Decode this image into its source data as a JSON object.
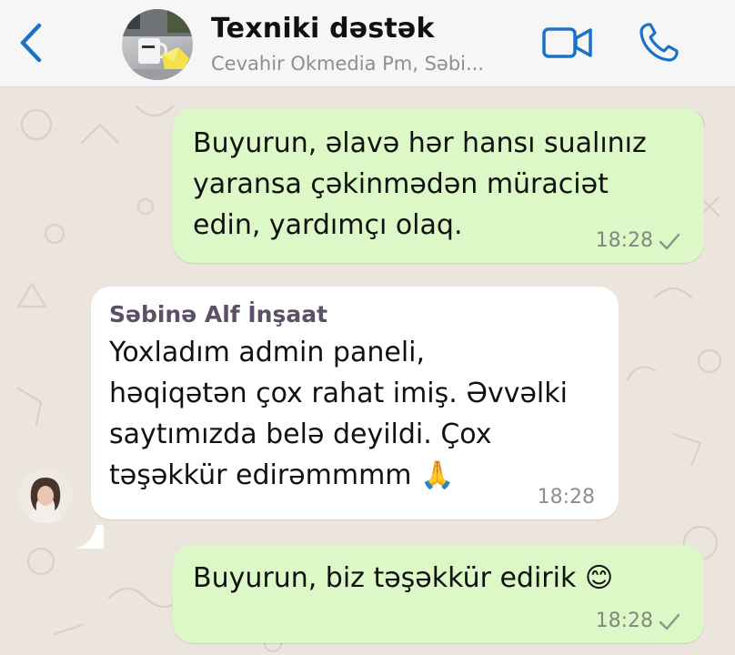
{
  "header": {
    "back_icon": "chevron-left-icon",
    "title": "Texniki dəstək",
    "subtitle": "Cevahir Okmedia Pm, Səbi...",
    "video_icon": "video-camera-icon",
    "call_icon": "phone-icon",
    "accent_color": "#1A73C8"
  },
  "messages": [
    {
      "direction": "outgoing",
      "lines": [
        "Buyurun, əlavə hər hansı sualınız",
        "yaransa çəkinmədən müraciət",
        "edin, yardımçı olaq."
      ],
      "time": "18:28",
      "status_icon": "single-check-icon"
    },
    {
      "direction": "incoming",
      "sender": "Səbinə Alf İnşaat",
      "lines": [
        "Yoxladım admin paneli,",
        "həqiqətən çox rahat imiş. Əvvəlki",
        "saytımızda belə deyildi. Çox",
        "təşəkkür edirəmmmm"
      ],
      "emoji": "🙏",
      "time": "18:28"
    },
    {
      "direction": "outgoing",
      "lines": [
        "Buyurun, biz təşəkkür edirik"
      ],
      "emoji": "😊",
      "time": "18:28",
      "status_icon": "single-check-icon"
    }
  ],
  "colors": {
    "outgoing_bubble": "#DCF8C6",
    "incoming_bubble": "#FFFFFF",
    "wallpaper": "#ECE5DD",
    "sender_name": "#5B5067"
  }
}
